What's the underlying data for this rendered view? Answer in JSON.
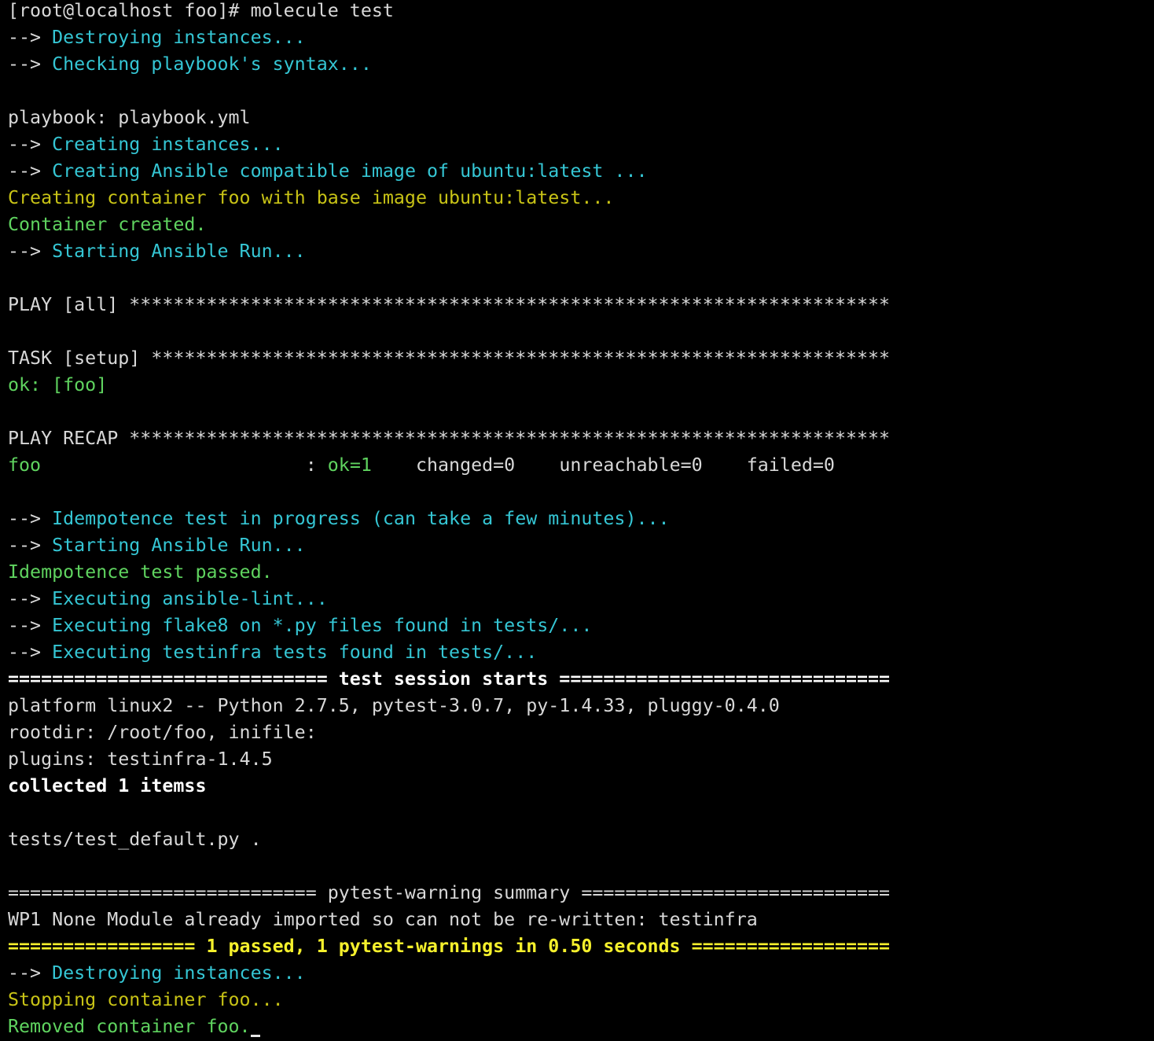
{
  "prompt": "[root@localhost foo]# molecule test",
  "lines": [
    {
      "parts": [
        {
          "text": "[root@localhost foo]# molecule test",
          "color": "default"
        }
      ]
    },
    {
      "parts": [
        {
          "text": "--> ",
          "color": "arrow"
        },
        {
          "text": "Destroying instances...",
          "color": "cyan"
        }
      ]
    },
    {
      "parts": [
        {
          "text": "--> ",
          "color": "arrow"
        },
        {
          "text": "Checking playbook's syntax...",
          "color": "cyan"
        }
      ]
    },
    {
      "parts": []
    },
    {
      "parts": [
        {
          "text": "playbook: playbook.yml",
          "color": "default"
        }
      ]
    },
    {
      "parts": [
        {
          "text": "--> ",
          "color": "arrow"
        },
        {
          "text": "Creating instances...",
          "color": "cyan"
        }
      ]
    },
    {
      "parts": [
        {
          "text": "--> ",
          "color": "arrow"
        },
        {
          "text": "Creating Ansible compatible image of ubuntu:latest ...",
          "color": "cyan"
        }
      ]
    },
    {
      "parts": [
        {
          "text": "Creating container foo with base image ubuntu:latest...",
          "color": "yellow"
        }
      ]
    },
    {
      "parts": [
        {
          "text": "Container created.",
          "color": "green"
        }
      ]
    },
    {
      "parts": [
        {
          "text": "--> ",
          "color": "arrow"
        },
        {
          "text": "Starting Ansible Run...",
          "color": "cyan"
        }
      ]
    },
    {
      "parts": []
    },
    {
      "parts": [
        {
          "text": "PLAY [all] *********************************************************************",
          "color": "default"
        }
      ]
    },
    {
      "parts": []
    },
    {
      "parts": [
        {
          "text": "TASK [setup] *******************************************************************",
          "color": "default"
        }
      ]
    },
    {
      "parts": [
        {
          "text": "ok: [foo]",
          "color": "green"
        }
      ]
    },
    {
      "parts": []
    },
    {
      "parts": [
        {
          "text": "PLAY RECAP *********************************************************************",
          "color": "default"
        }
      ]
    },
    {
      "parts": [
        {
          "text": "foo",
          "color": "green"
        },
        {
          "text": "                        : ",
          "color": "default"
        },
        {
          "text": "ok=1",
          "color": "green"
        },
        {
          "text": "    changed=0    unreachable=0    failed=0",
          "color": "default"
        }
      ]
    },
    {
      "parts": []
    },
    {
      "parts": [
        {
          "text": "--> ",
          "color": "arrow"
        },
        {
          "text": "Idempotence test in progress (can take a few minutes)...",
          "color": "cyan"
        }
      ]
    },
    {
      "parts": [
        {
          "text": "--> ",
          "color": "arrow"
        },
        {
          "text": "Starting Ansible Run...",
          "color": "cyan"
        }
      ]
    },
    {
      "parts": [
        {
          "text": "Idempotence test passed.",
          "color": "green"
        }
      ]
    },
    {
      "parts": [
        {
          "text": "--> ",
          "color": "arrow"
        },
        {
          "text": "Executing ansible-lint...",
          "color": "cyan"
        }
      ]
    },
    {
      "parts": [
        {
          "text": "--> ",
          "color": "arrow"
        },
        {
          "text": "Executing flake8 on *.py files found in tests/...",
          "color": "cyan"
        }
      ]
    },
    {
      "parts": [
        {
          "text": "--> ",
          "color": "arrow"
        },
        {
          "text": "Executing testinfra tests found in tests/...",
          "color": "cyan"
        }
      ]
    },
    {
      "parts": [
        {
          "text": "============================= test session starts ==============================",
          "color": "bold"
        }
      ]
    },
    {
      "parts": [
        {
          "text": "platform linux2 -- Python 2.7.5, pytest-3.0.7, py-1.4.33, pluggy-0.4.0",
          "color": "default"
        }
      ]
    },
    {
      "parts": [
        {
          "text": "rootdir: /root/foo, inifile:",
          "color": "default"
        }
      ]
    },
    {
      "parts": [
        {
          "text": "plugins: testinfra-1.4.5",
          "color": "default"
        }
      ]
    },
    {
      "parts": [
        {
          "text": "collected 1 itemss",
          "color": "bold"
        }
      ]
    },
    {
      "parts": []
    },
    {
      "parts": [
        {
          "text": "tests/test_default.py .",
          "color": "default"
        }
      ]
    },
    {
      "parts": []
    },
    {
      "parts": [
        {
          "text": "============================ pytest-warning summary ============================",
          "color": "default"
        }
      ]
    },
    {
      "parts": [
        {
          "text": "WP1 None Module already imported so can not be re-written: testinfra",
          "color": "default"
        }
      ]
    },
    {
      "parts": [
        {
          "text": "================= 1 passed, 1 pytest-warnings in 0.50 seconds ==================",
          "color": "byellow"
        }
      ]
    },
    {
      "parts": [
        {
          "text": "--> ",
          "color": "arrow"
        },
        {
          "text": "Destroying instances...",
          "color": "cyan"
        }
      ]
    },
    {
      "parts": [
        {
          "text": "Stopping container foo...",
          "color": "yellow"
        }
      ]
    },
    {
      "parts": [
        {
          "text": "Removed container foo.",
          "color": "green"
        }
      ]
    }
  ],
  "colors": {
    "background": "#000000",
    "default": "#d8d8d8",
    "cyan": "#35c6d4",
    "yellow": "#c8c316",
    "green": "#5fd35f",
    "bold": "#ffffff",
    "bright_yellow": "#f5f02c"
  }
}
